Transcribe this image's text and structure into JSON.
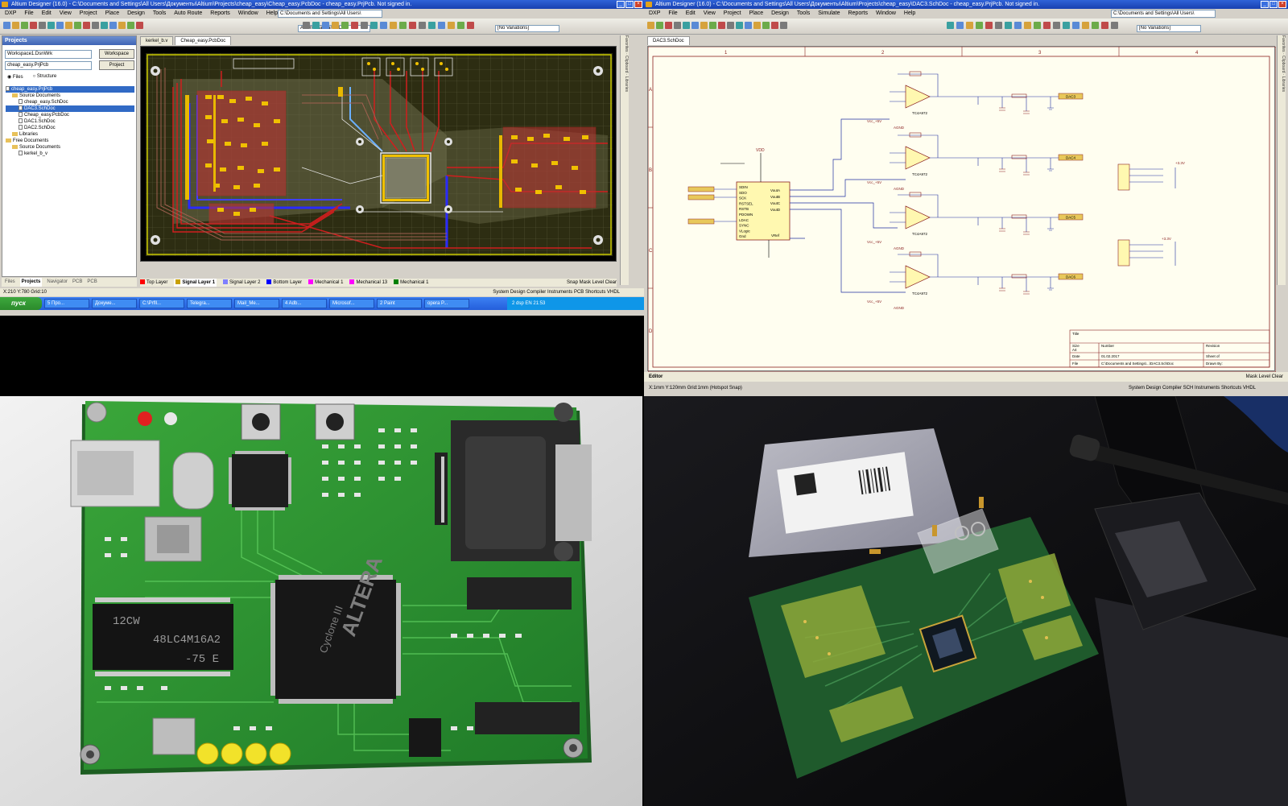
{
  "pcb_window": {
    "title": "Altium Designer (16.0) - C:\\Documents and Settings\\All Users\\Документы\\Altium\\Projects\\cheap_easy\\Cheap_easy.PcbDoc - cheap_easy.PrjPcb. Not signed in.",
    "menu": [
      "DXP",
      "File",
      "Edit",
      "View",
      "Project",
      "Place",
      "Design",
      "Tools",
      "Auto Route",
      "Reports",
      "Window",
      "Help"
    ],
    "path": "C:\\Documents and Settings\\All Users\\",
    "view_combo": "Altium Standard 2D",
    "variations_combo": "[No Variations]",
    "projects_panel": {
      "title": "Projects",
      "workspace_field": "Workspace1.DsnWrk",
      "workspace_button": "Workspace",
      "project_field": "cheap_easy.PrjPcb",
      "project_button": "Project",
      "view_files": "Files",
      "view_structure": "Structure",
      "tree": [
        {
          "label": "cheap_easy.PrjPcb",
          "level": 0,
          "kind": "doc",
          "selected": true
        },
        {
          "label": "Source Documents",
          "level": 1,
          "kind": "folder",
          "selected": false
        },
        {
          "label": "cheap_easy.SchDoc",
          "level": 2,
          "kind": "doc",
          "selected": false
        },
        {
          "label": "DAC3.SchDoc",
          "level": 2,
          "kind": "doc",
          "selected": true
        },
        {
          "label": "Cheap_easy.PcbDoc",
          "level": 2,
          "kind": "doc",
          "selected": false
        },
        {
          "label": "DAC1.SchDoc",
          "level": 2,
          "kind": "doc",
          "selected": false
        },
        {
          "label": "DAC2.SchDoc",
          "level": 2,
          "kind": "doc",
          "selected": false
        },
        {
          "label": "Libraries",
          "level": 1,
          "kind": "folder",
          "selected": false
        },
        {
          "label": "Free Documents",
          "level": 0,
          "kind": "folder",
          "selected": false
        },
        {
          "label": "Source Documents",
          "level": 1,
          "kind": "folder",
          "selected": false
        },
        {
          "label": "kerkel_b_v",
          "level": 2,
          "kind": "doc",
          "selected": false
        }
      ],
      "tabs": [
        "Files",
        "Projects",
        "Navigator",
        "PCB",
        "PCB"
      ]
    },
    "doc_tabs": [
      "kerkel_b.v",
      "Cheap_easy.PcbDoc"
    ],
    "layer_tabs": [
      {
        "label": "Top Layer",
        "color": "#ff0000"
      },
      {
        "label": "Signal Layer 1",
        "color": "#c8a000"
      },
      {
        "label": "Signal Layer 2",
        "color": "#7f7fff"
      },
      {
        "label": "Bottom Layer",
        "color": "#0000ff"
      },
      {
        "label": "Mechanical 1",
        "color": "#ff00ff"
      },
      {
        "label": "Mechanical 13",
        "color": "#ff00ff"
      },
      {
        "label": "Mechanical 1",
        "color": "#008000"
      }
    ],
    "layer_right": "Snap  Mask Level  Clear",
    "status_left": "X:210 Y:780   Grid:10",
    "status_right": "System   Design Compiler   Instruments   PCB   Shortcuts   VHDL",
    "taskbar": {
      "start": "пуск",
      "tasks": [
        "5 Про...",
        "Докумe...",
        "C:\\Prfll...",
        "Telegra...",
        "Mail_Me...",
        "4 Adb...",
        "Microsof...",
        "2 Paint",
        "opera P..."
      ],
      "tray_text": "2 dsp",
      "lang": "EN",
      "clock": "21:53"
    }
  },
  "sch_window": {
    "title": "Altium Designer (16.0) - C:\\Documents and Settings\\All Users\\Документы\\Altium\\Projects\\cheap_easy\\DAC3.SchDoc - cheap_easy.PrjPcb. Not signed in.",
    "menu": [
      "DXP",
      "File",
      "Edit",
      "View",
      "Project",
      "Place",
      "Design",
      "Tools",
      "Simulate",
      "Reports",
      "Window",
      "Help"
    ],
    "path": "C:\\Documents and Settings\\All Users\\",
    "variations_combo": "[No Variations]",
    "doc_tab": "DAC3.SchDoc",
    "zone_columns": [
      "1",
      "2",
      "3",
      "4"
    ],
    "zone_rows": [
      "A",
      "B",
      "C",
      "D"
    ],
    "dac_chip": {
      "pins_left": [
        "SDIN",
        "SDO",
        "SCK",
        "RSTSEL",
        "RSTB",
        "PDOWN",
        "LDAC",
        "SYNC",
        "VLogic",
        "Gnd"
      ],
      "pins_right": [
        "VoutA",
        "VoutB",
        "VoutC",
        "VoutD",
        "",
        "",
        "",
        "VRef"
      ],
      "label": "VDD"
    },
    "net_labels": [
      "DAC3",
      "DAC4",
      "DAC5",
      "DAC6"
    ],
    "opamp_label": "TC4A972",
    "power_labels": [
      "Vcc_+5V",
      "AGND",
      "+3.3V"
    ],
    "title_block": {
      "title": "Title",
      "size": "Size",
      "size_value": "A4",
      "number": "Number",
      "revision": "Revision",
      "date_label": "Date",
      "date": "01.02.2017",
      "sheet": "Sheet   of",
      "file_label": "File",
      "file": "C:\\Documents and Settings\\...\\DAC3.SchDoc",
      "drawn_by": "Drawn By:"
    },
    "editor_label": "Editor",
    "status_left": "X:1mm Y:120mm   Grid:1mm   (Hotspot Snap)",
    "status_right": "System   Design Compiler   SCH   Instruments   Shortcuts   VHDL",
    "mask": "Mask Level   Clear"
  },
  "photo_board": {
    "sdram_lines": [
      "12CW",
      "48LC4M16A2",
      "-75 E"
    ],
    "fpga_lines": [
      "ALTERA",
      "Cyclone III"
    ],
    "connector": "DB-9",
    "leds": 4,
    "buttons": 2
  },
  "photo_workbench": {
    "bag_label": "ESD bag",
    "board_colour": "#1f5a2c"
  }
}
